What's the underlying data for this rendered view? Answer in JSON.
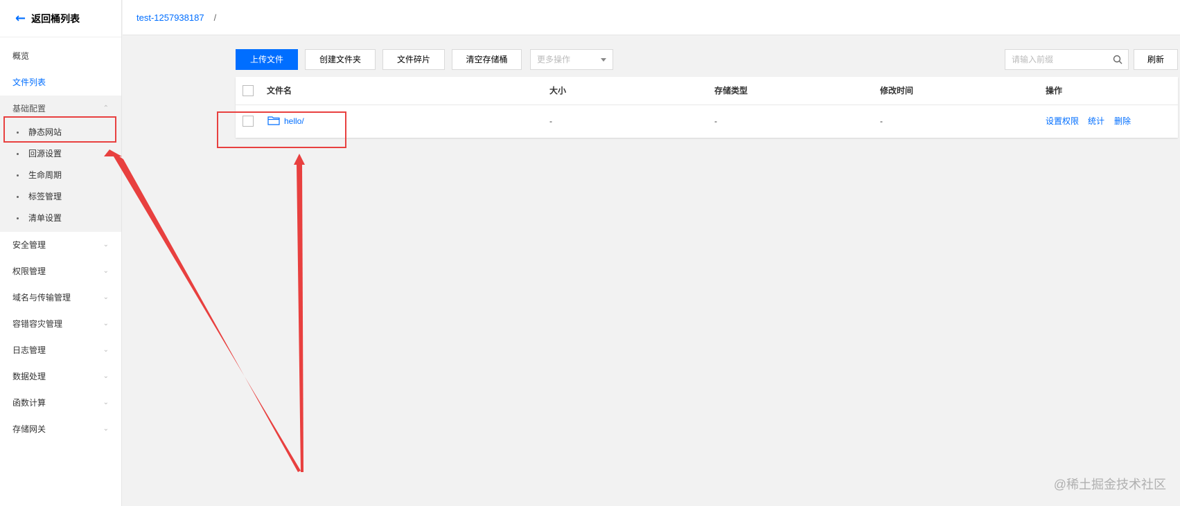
{
  "sidebar": {
    "back_label": "返回桶列表",
    "items": [
      {
        "label": "概览"
      },
      {
        "label": "文件列表"
      }
    ],
    "group": {
      "label": "基础配置",
      "children": [
        {
          "label": "静态网站"
        },
        {
          "label": "回源设置"
        },
        {
          "label": "生命周期"
        },
        {
          "label": "标签管理"
        },
        {
          "label": "清单设置"
        }
      ]
    },
    "collapsed": [
      {
        "label": "安全管理"
      },
      {
        "label": "权限管理"
      },
      {
        "label": "域名与传输管理"
      },
      {
        "label": "容错容灾管理"
      },
      {
        "label": "日志管理"
      },
      {
        "label": "数据处理"
      },
      {
        "label": "函数计算"
      },
      {
        "label": "存储网关"
      }
    ]
  },
  "breadcrumb": {
    "bucket": "test-1257938187",
    "separator": "/"
  },
  "toolbar": {
    "upload_label": "上传文件",
    "create_folder_label": "创建文件夹",
    "fragments_label": "文件碎片",
    "clear_bucket_label": "清空存储桶",
    "more_actions_placeholder": "更多操作",
    "search_placeholder": "请输入前缀",
    "refresh_label": "刷新"
  },
  "table": {
    "columns": [
      "文件名",
      "大小",
      "存储类型",
      "修改时间",
      "操作"
    ],
    "rows": [
      {
        "name": "hello/",
        "size": "-",
        "storage_class": "-",
        "modified": "-",
        "actions": [
          "设置权限",
          "统计",
          "删除"
        ]
      }
    ]
  },
  "watermark": "@稀土掘金技术社区",
  "colors": {
    "accent": "#006eff",
    "annotation": "#e8403f",
    "background": "#f2f2f2"
  }
}
